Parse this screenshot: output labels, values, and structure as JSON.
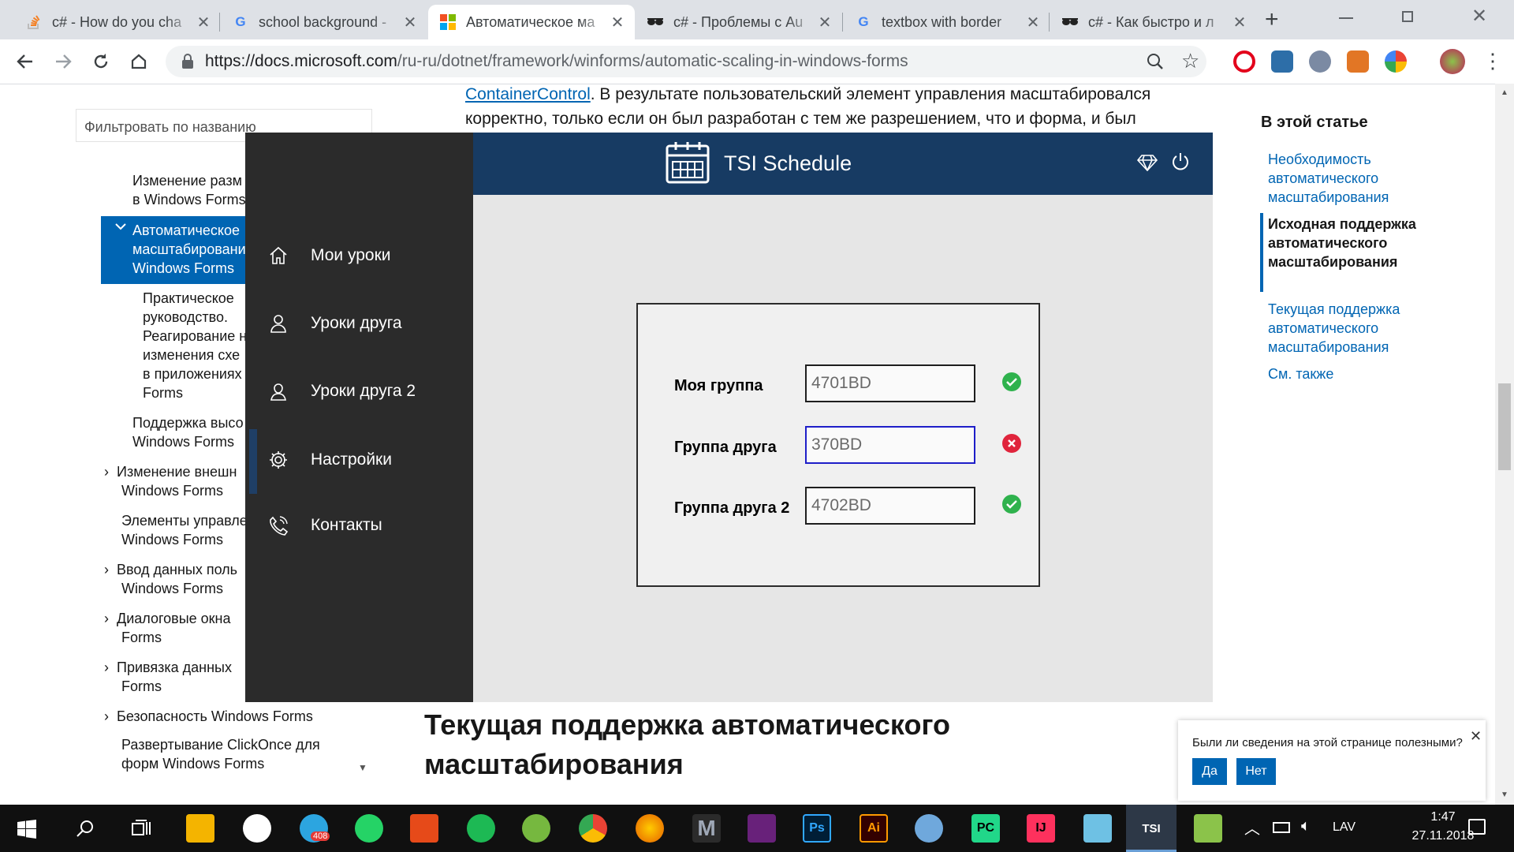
{
  "browser": {
    "tabs": [
      {
        "title": "c# - How do you cha",
        "favicon": "stackoverflow-icon",
        "active": false
      },
      {
        "title": "school background -",
        "favicon": "google-icon",
        "active": false
      },
      {
        "title": "Автоматическое ма",
        "favicon": "microsoft-icon",
        "active": true
      },
      {
        "title": "c# - Проблемы с Au",
        "favicon": "sunglasses-icon",
        "active": false
      },
      {
        "title": "textbox with border",
        "favicon": "google-icon",
        "active": false
      },
      {
        "title": "c# - Как быстро и л",
        "favicon": "sunglasses-icon",
        "active": false
      }
    ],
    "new_tab": "+",
    "url_host": "https://docs.microsoft.com",
    "url_path": "/ru-ru/dotnet/framework/winforms/automatic-scaling-in-windows-forms"
  },
  "docs": {
    "filter_placeholder": "Фильтровать по названию",
    "toc": {
      "item1": "Изменение разм",
      "item1b": "в Windows Forms",
      "active1": "Автоматическое",
      "active2": "масштабировани",
      "active3": "Windows Forms",
      "sub1": "Практическое",
      "sub2": "руководство.",
      "sub3": "Реагирование н",
      "sub4": "изменения схе",
      "sub5": "в приложениях",
      "sub6": "Forms",
      "item2": "Поддержка высо",
      "item2b": "Windows Forms",
      "item3": "Изменение внешн",
      "item3b": "Windows Forms",
      "item4": "Элементы управле",
      "item4b": "Windows Forms",
      "item5": "Ввод данных поль",
      "item5b": "Windows Forms",
      "item6": "Диалоговые окна",
      "item6b": "Forms",
      "item7": "Привязка данных",
      "item7b": "Forms",
      "item8": "Безопасность Windows Forms",
      "item9": "Развертывание ClickOnce для",
      "item9b": "форм Windows Forms"
    },
    "para_link": "ContainerControl",
    "para_text1": ". В результате пользовательский элемент управления масштабировался",
    "para_text2": "корректно, только если он был разработан с тем же разрешением, что и форма, и был",
    "heading": "Текущая поддержка автоматического",
    "heading2": "масштабирования",
    "in_article_title": "В этой статье",
    "in_article": {
      "l1": "Необходимость автоматического масштабирования",
      "l2": "Исходная поддержка автоматического масштабирования",
      "l3": "Текущая поддержка автоматического масштабирования",
      "l4": "См. также"
    },
    "feedback": {
      "question": "Были ли сведения на этой странице полезными?",
      "yes": "Да",
      "no": "Нет"
    }
  },
  "app": {
    "title": "TSI Schedule",
    "menu": {
      "m1": "Мои  уроки",
      "m2": "Уроки друга",
      "m3": "Уроки друга 2",
      "m4": "Настройки",
      "m5": "Контакты"
    },
    "form": {
      "label1": "Моя группа",
      "value1": "4701BD",
      "status1": "valid",
      "label2": "Группа друга",
      "value2": "370BD",
      "status2": "invalid",
      "label3": "Группа друга 2",
      "value3": "4702BD",
      "status3": "valid"
    },
    "colors": {
      "header": "#173b63",
      "sidebar": "#2b2b2b",
      "valid": "#2fb24d",
      "invalid": "#e0243c"
    }
  },
  "taskbar": {
    "telegram_badge": "408",
    "active_app": "TSI",
    "language": "LAV",
    "time": "1:47",
    "date": "27.11.2018"
  }
}
